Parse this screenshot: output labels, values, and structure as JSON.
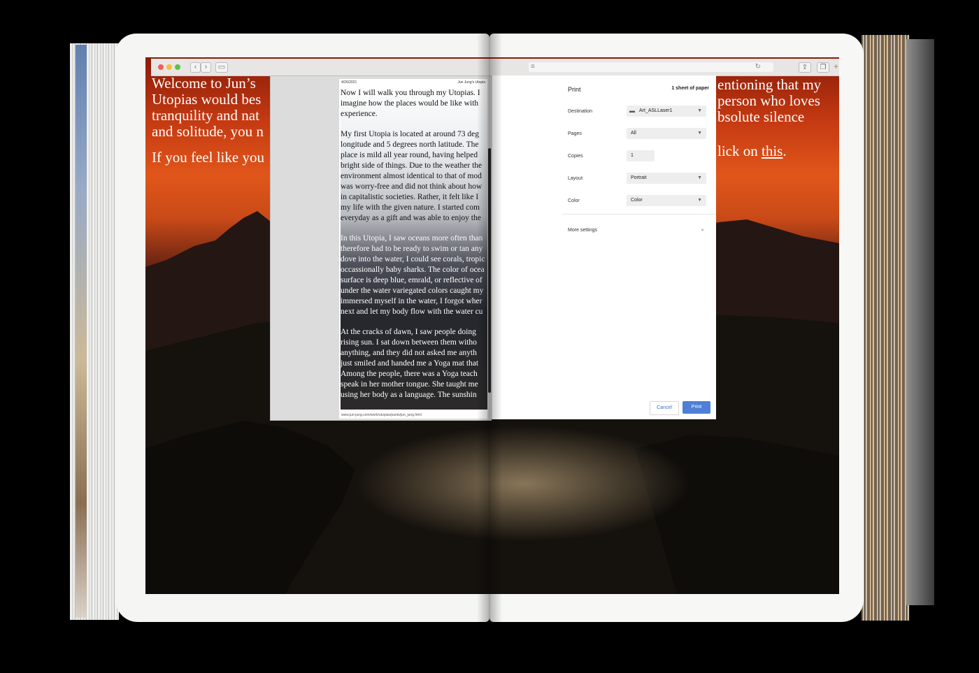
{
  "browser": {
    "window_colors": {
      "close": "#f25f58",
      "minimize": "#f9bd2f",
      "maximize": "#58c443"
    },
    "back_icon": "chevron-left",
    "forward_icon": "chevron-right",
    "sidebar_icon": "sidebar",
    "address_icon": "lines",
    "reload_icon": "reload",
    "share_icon": "share",
    "tabs_icon": "tabs",
    "add_tab_icon": "+"
  },
  "webpage": {
    "left_lines": [
      "Welcome to Jun’s",
      "Utopias would bes",
      "tranquility and nat",
      "and solitude, you n"
    ],
    "left_line_last": "If you feel like you",
    "right_lines": [
      "entioning that my",
      "person who loves",
      "bsolute silence"
    ],
    "right_line_prefix": "lick on ",
    "right_link": "this",
    "right_line_suffix": "."
  },
  "preview": {
    "header_left": "4/26/2021",
    "header_right": "Jun Jung’s Utopia",
    "paragraphs": [
      [
        "Now I will walk you through my Utopias. I",
        "imagine how the places would be like with",
        "experience."
      ],
      [
        "My first Utopia is located at around 73 deg",
        "longitude and 5 degrees north latitude. The",
        "place is mild all year round, having helped",
        "bright side of things. Due to the weather the",
        "environment almost identical to that of mod",
        "was worry-free and did not think about how",
        "in capitalistic societies. Rather, it felt like I",
        "my life with the given nature. I started com",
        "everyday as a gift and was able to enjoy the"
      ],
      [
        "In this Utopia, I saw oceans more often than",
        "therefore had to be ready to swim or tan any",
        "dove into the water, I could see corals, tropic",
        "occassionally baby sharks. The color of ocea",
        "surface is deep blue, emrald, or reflective of",
        "under the water variegated colors caught my",
        "immersed myself in the water, I forgot wher",
        "next and let my body flow with the water cu"
      ],
      [
        "At the cracks of dawn, I saw people doing",
        "rising sun. I sat down between them witho",
        "anything, and they did not asked me anyth",
        "just smiled and handed me a Yoga mat that",
        "Among the people, there was a Yoga teach",
        "speak in her mother tongue. She taught me",
        "using her body as a language. The sunshin"
      ]
    ],
    "footer": "www.jun-jung.com/work/utopias/pants/jun_jung.html"
  },
  "print_dialog": {
    "title": "Print",
    "sheets": "1 sheet of paper",
    "destination_label": "Destination",
    "destination_value": "Art_ASLLaser1",
    "pages_label": "Pages",
    "pages_value": "All",
    "copies_label": "Copies",
    "copies_value": "1",
    "layout_label": "Layout",
    "layout_value": "Portrait",
    "color_label": "Color",
    "color_value": "Color",
    "more_settings": "More settings",
    "cancel": "Cancel",
    "print": "Print",
    "accent": "#4f7fd6"
  }
}
